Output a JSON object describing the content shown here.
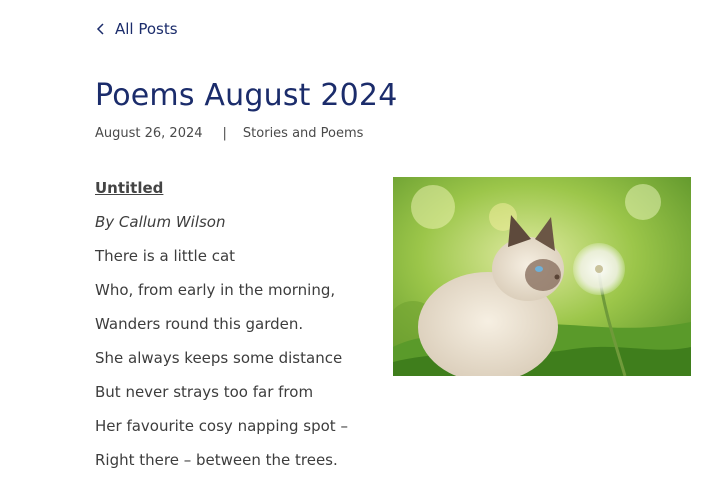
{
  "nav": {
    "back_label": "All Posts",
    "back_icon": "chevron-left-icon"
  },
  "post": {
    "title": "Poems August 2024",
    "date": "August 26, 2024",
    "separator": "|",
    "category": "Stories and Poems"
  },
  "poem": {
    "title": "Untitled ",
    "author": "By Callum Wilson",
    "lines": [
      "There is a little cat",
      "Who, from early in the morning,",
      "Wanders round this garden.",
      "She always keeps some distance",
      "But never strays too far from",
      "Her favourite cosy napping spot –",
      "Right there – between the trees."
    ]
  },
  "image": {
    "subject": "kitten-with-dandelion-photo"
  },
  "colors": {
    "title": "#1b2c6b",
    "text": "#3d3d3d",
    "meta": "#4a4a4a"
  }
}
